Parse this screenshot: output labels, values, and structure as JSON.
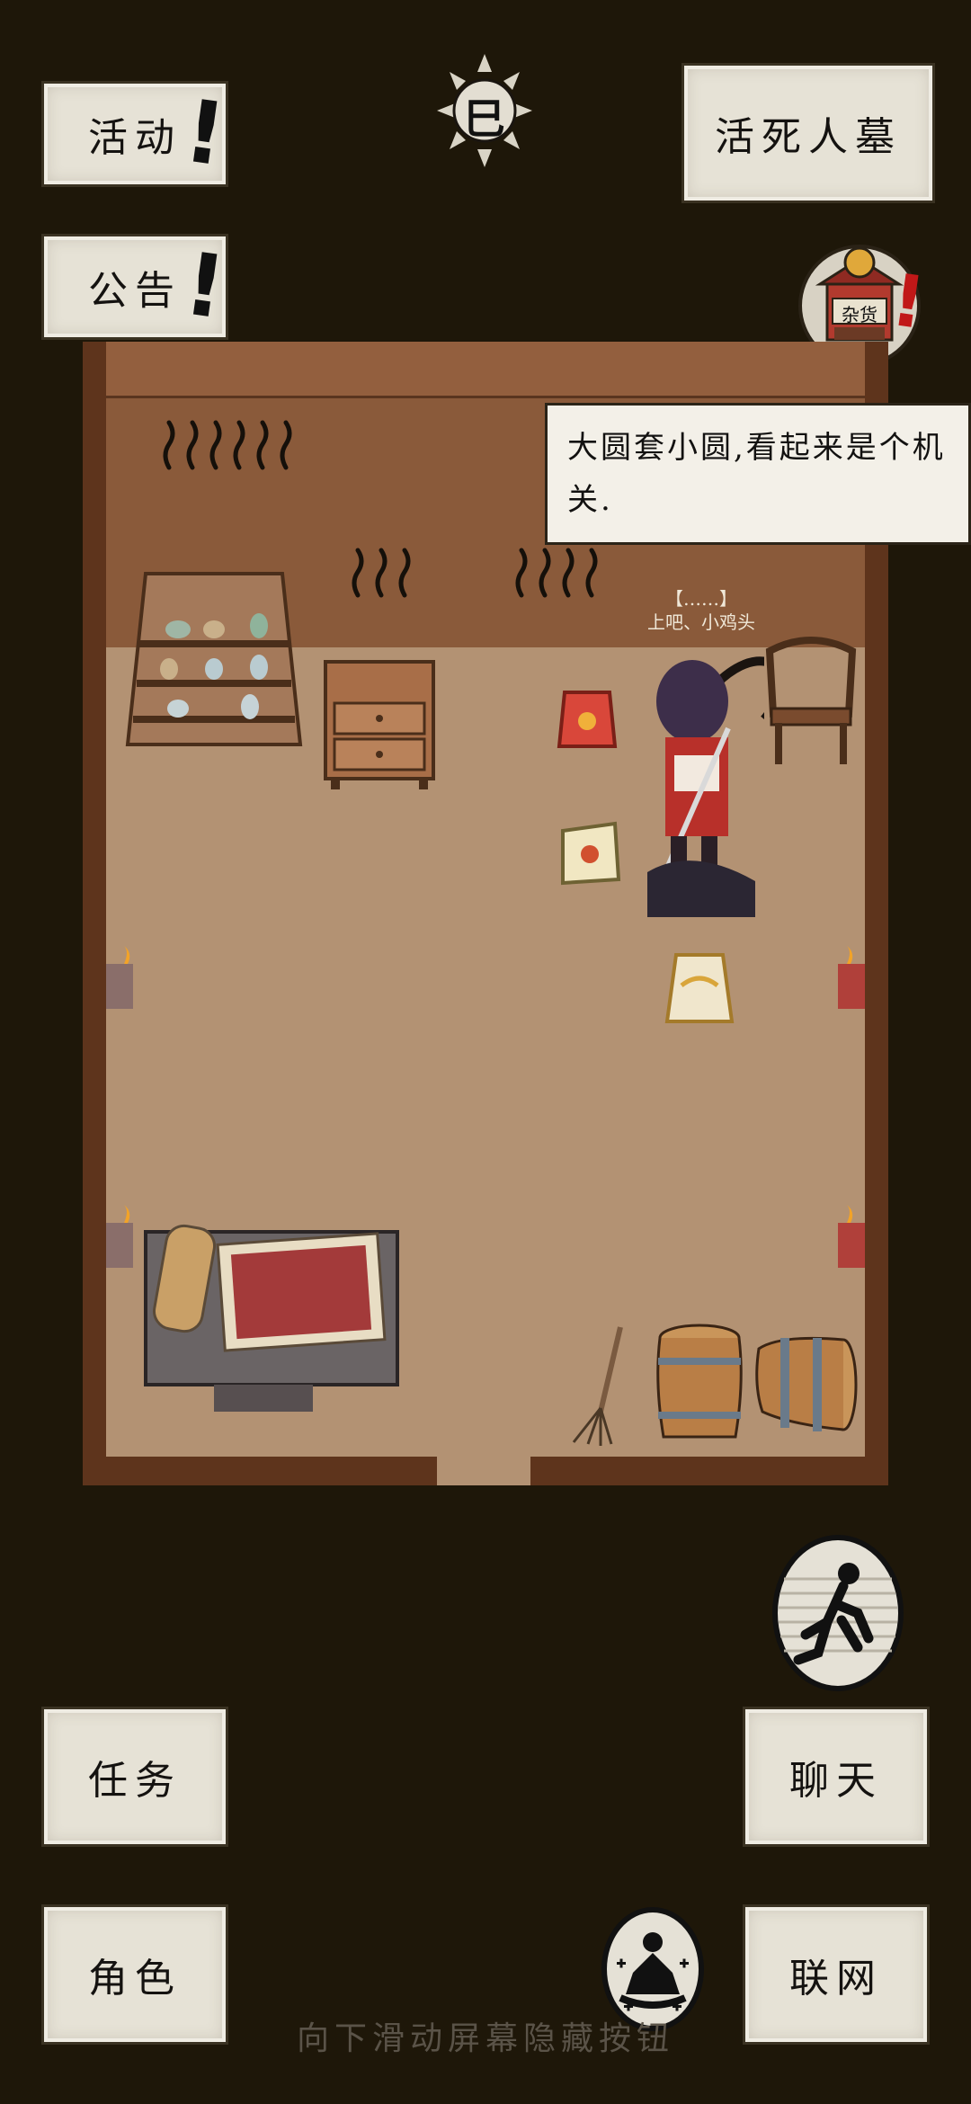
{
  "top_left": {
    "activity_label": "活动",
    "notice_label": "公告"
  },
  "time_badge": {
    "glyph": "巳",
    "icon": "sun-icon"
  },
  "location": {
    "label": "活死人墓"
  },
  "shop": {
    "label": "杂货",
    "icon": "general-store-icon"
  },
  "dialog": {
    "text": "大圆套小圆,看起来是个机关."
  },
  "player_tag": {
    "line1": "【……】",
    "line2": "上吧、小鸡头"
  },
  "bottom": {
    "task_label": "任务",
    "character_label": "角色",
    "chat_label": "聊天",
    "network_label": "联网"
  },
  "hint": {
    "text": "向下滑动屏幕隐藏按钮"
  },
  "icons": [
    "exclamation-icon",
    "run-icon",
    "meditation-icon",
    "torch-icon"
  ],
  "colors": {
    "background": "#1e1709",
    "button_paper": "#e6e2d6",
    "floor": "#b39273",
    "wall": "#8a5a3a",
    "alert_red": "#c11818"
  }
}
